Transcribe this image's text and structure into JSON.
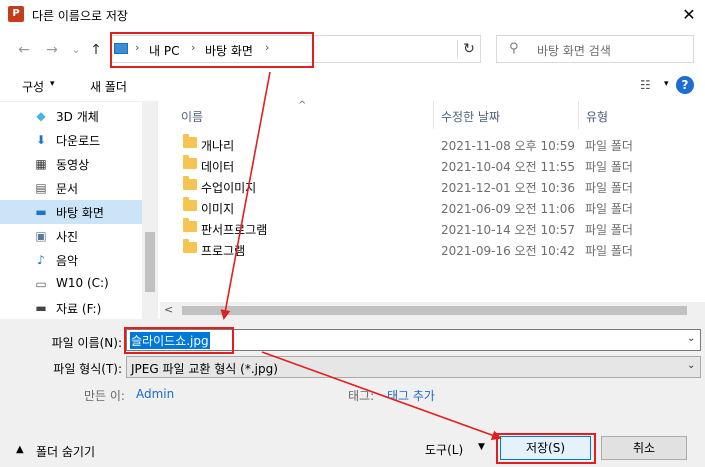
{
  "window": {
    "title": "다른 이름으로 저장",
    "app_icon_letter": "P",
    "close_glyph": "✕"
  },
  "nav": {
    "back": "←",
    "forward": "→",
    "dropdown": "⌄",
    "up": "↑",
    "refresh": "↻"
  },
  "address": {
    "sep": "›",
    "parts": [
      "내 PC",
      "바탕 화면"
    ]
  },
  "search": {
    "placeholder": "바탕 화면 검색",
    "icon": "search-icon"
  },
  "toolbar": {
    "organize": "구성",
    "organize_caret": "▾",
    "new_folder": "새 폴더",
    "view_glyph": "☷",
    "view_caret": "▾",
    "help": "?"
  },
  "sidebar": {
    "items": [
      {
        "label": "3D 개체",
        "icon": "cube-icon",
        "glyph": "◆",
        "color": "#3fb7e6"
      },
      {
        "label": "다운로드",
        "icon": "download-icon",
        "glyph": "⬇",
        "color": "#1e73c8"
      },
      {
        "label": "동영상",
        "icon": "video-icon",
        "glyph": "▦",
        "color": "#333333"
      },
      {
        "label": "문서",
        "icon": "document-icon",
        "glyph": "▤",
        "color": "#555555"
      },
      {
        "label": "바탕 화면",
        "icon": "desktop-icon",
        "glyph": "▬",
        "color": "#1e73c8"
      },
      {
        "label": "사진",
        "icon": "picture-icon",
        "glyph": "▣",
        "color": "#5a7a9a"
      },
      {
        "label": "음악",
        "icon": "music-icon",
        "glyph": "♪",
        "color": "#1e73c8"
      },
      {
        "label": "W10 (C:)",
        "icon": "drive-icon",
        "glyph": "▭",
        "color": "#666666"
      },
      {
        "label": "자료 (F:)",
        "icon": "drive-icon",
        "glyph": "▬",
        "color": "#444444"
      }
    ],
    "selected_index": 4
  },
  "list": {
    "sort_glyph": "^",
    "headers": {
      "name": "이름",
      "date": "수정한 날짜",
      "type": "유형"
    },
    "rows": [
      {
        "name": "개나리",
        "date": "2021-11-08 오후 10:59",
        "type": "파일 폴더"
      },
      {
        "name": "데이터",
        "date": "2021-10-04 오전 11:55",
        "type": "파일 폴더"
      },
      {
        "name": "수업이미지",
        "date": "2021-12-01 오전 10:36",
        "type": "파일 폴더"
      },
      {
        "name": "이미지",
        "date": "2021-06-09 오전 11:06",
        "type": "파일 폴더"
      },
      {
        "name": "판서프로그램",
        "date": "2021-10-14 오전 10:57",
        "type": "파일 폴더"
      },
      {
        "name": "프로그램",
        "date": "2021-09-16 오전 10:42",
        "type": "파일 폴더"
      }
    ],
    "scroll_left": "<"
  },
  "form": {
    "filename_label": "파일 이름(N):",
    "filename_value": "슬라이드쇼.jpg",
    "filetype_label": "파일 형식(T):",
    "filetype_value": "JPEG 파일 교환 형식 (*.jpg)",
    "caret": "⌄",
    "author_label": "만든 이:",
    "author_value": "Admin",
    "tags_label": "태그:",
    "tags_value": "태그 추가"
  },
  "footer": {
    "hide_folders_caret": "▲",
    "hide_folders": "폴더 숨기기",
    "tools": "도구(L)",
    "tools_caret": "▼",
    "save": "저장(S)",
    "cancel": "취소"
  },
  "colors": {
    "annotation": "#e02020",
    "selection": "#cce4f7",
    "accent": "#0078d7"
  }
}
